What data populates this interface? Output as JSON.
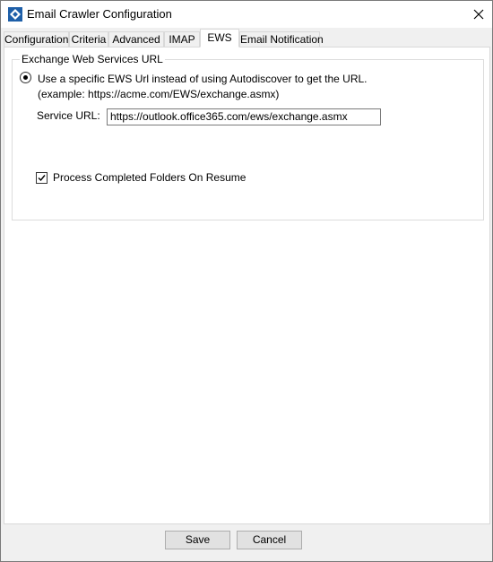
{
  "window": {
    "title": "Email Crawler Configuration"
  },
  "tabs": [
    {
      "label": "Configuration"
    },
    {
      "label": "Criteria"
    },
    {
      "label": "Advanced"
    },
    {
      "label": "IMAP"
    },
    {
      "label": "EWS",
      "active": true
    },
    {
      "label": "Email Notification"
    }
  ],
  "ews": {
    "group_title": "Exchange Web Services URL",
    "radio_label": "Use a specific EWS Url instead of using Autodiscover to get the URL.",
    "radio_selected": true,
    "example": "(example: https://acme.com/EWS/exchange.asmx)",
    "service_url_label": "Service URL:",
    "service_url_value": "https://outlook.office365.com/ews/exchange.asmx",
    "process_completed_label": "Process Completed Folders On Resume",
    "process_completed_checked": true
  },
  "footer": {
    "save_label": "Save",
    "cancel_label": "Cancel"
  },
  "icons": {
    "app": "app-diamond-icon",
    "close": "close-icon",
    "radio": "radio-selected-icon",
    "check": "checkmark-icon"
  },
  "colors": {
    "icon_blue": "#1e5fa8",
    "tab_border": "#d9d9d9",
    "panel_bg": "#ffffff",
    "window_bg": "#f0f0f0"
  }
}
